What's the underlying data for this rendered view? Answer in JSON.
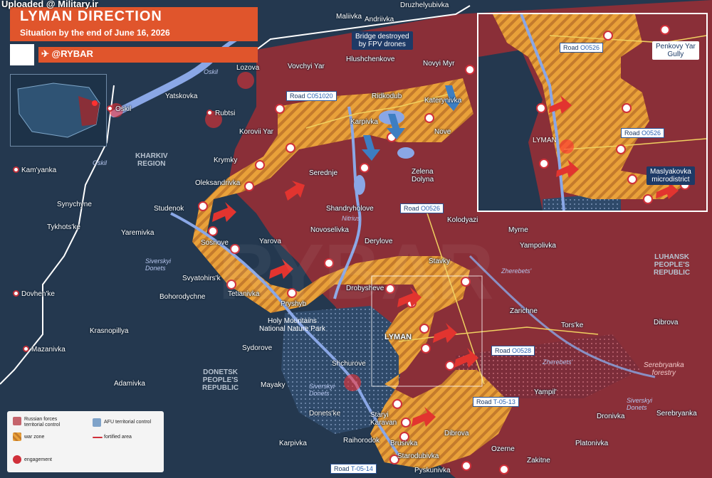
{
  "header": {
    "title": "LYMAN DIRECTION",
    "subtitle": "Situation by the end of June 16, 2026",
    "brand": "@RYBAR",
    "watermark": "Uploaded @ Military.ir"
  },
  "colors": {
    "russian_control": "#8a2f38",
    "afu_control": "#24384f",
    "war_zone": "#e9a13a",
    "river": "#8aa7e6",
    "accent": "#e0552c"
  },
  "settlements": {
    "oskil": "Oskil",
    "lozova": "Lozova",
    "yatskovka": "Yatskovka",
    "rubtsi": "Rubtsi",
    "vovchyi_yar": "Vovchyi Yar",
    "maliivka": "Maliivka",
    "andriivka": "Andriivka",
    "druzhelyubivka": "Druzhelyubivka",
    "hlushchenkove": "Hlushchenkove",
    "novyi_myr": "Novyi Myr",
    "ridkodub": "Ridkodub",
    "katerynivka": "Katerynivka",
    "karpivka_n": "Karpivka",
    "nove": "Nove",
    "korovii_yar": "Korovii Yar",
    "krymky": "Krymky",
    "serednje": "Serednje",
    "zelena_dolyna": "Zelena\nDolyna",
    "kamyanka": "Kam'yanka",
    "oleksandrivka": "Oleksandrivka",
    "synychyne": "Synychyne",
    "studenok": "Studenok",
    "shandryholove": "Shandryholove",
    "tykhotske": "Tykhots'ke",
    "yaremivka": "Yaremivka",
    "novoselivka": "Novoselivka",
    "kolodyazi": "Kolodyazi",
    "sosnove": "Sosnove",
    "yarova": "Yarova",
    "derylove": "Derylove",
    "myrne": "Myrne",
    "yampolivka": "Yampolivka",
    "stavky": "Stavky",
    "svyatohirsk": "Svyatohirs'k",
    "drobysheve": "Drobysheve",
    "dovhenke": "Dovhen'ke",
    "bohorodychne": "Bohorodychne",
    "tetianivka": "Tetianivka",
    "pryshyb": "Pryshyb",
    "zarichne": "Zarichne",
    "torske": "Tors'ke",
    "dibrova_e": "Dibrova",
    "krasnopillya": "Krasnopillya",
    "lyman": "LYMAN",
    "mazanivka": "Mazanivka",
    "sydorove": "Sydorove",
    "shchurove": "Shchurove",
    "adamivka": "Adamivka",
    "mayaky": "Mayaky",
    "yampil": "Yampil'",
    "donetske": "Donets'ke",
    "staryi_karavan": "Staryi\nKaravan",
    "dronivka": "Dronivka",
    "serebryanka": "Serebryanka",
    "raihorodok": "Raihorodok",
    "brusivka": "Brusivka",
    "dibrova_s": "Dibrova",
    "starodubivka": "Starodubivka",
    "karpivka_s": "Karpivka",
    "ozerne": "Ozerne",
    "platonivka": "Platonivka",
    "zakitne": "Zakitne",
    "pyskunivka": "Pyskunivka"
  },
  "regions": {
    "kharkiv": "KHARKIV\nREGION",
    "donetsk": "DONETSK\nPEOPLE'S\nREPUBLIC",
    "luhansk": "LUHANSK\nPEOPLE'S\nREPUBLIC",
    "holy_mountains": "Holy Mountains\nNational Nature Park",
    "serebryanka_forestry": "Serebryanka\nforestry"
  },
  "rivers": {
    "oskil_n": "Oskil",
    "oskil_w": "Oskil",
    "nitrius": "Nitrius",
    "siverskyi_donets_w": "Siverskyi\nDonets",
    "zherebets_1": "Zherebets'",
    "zherebets_2": "Zherebets'",
    "siverskyi_donets_c": "Siverskyi\nDonets",
    "siverskyi_donets_e": "Siverskyi\nDonets"
  },
  "roads": {
    "c051020": {
      "prefix": "Road",
      "code": "C051020"
    },
    "o0526_main": {
      "prefix": "Road",
      "code": "O0526"
    },
    "o0528": {
      "prefix": "Road",
      "code": "O0528"
    },
    "t0513": {
      "prefix": "Road",
      "code": "T-05-13"
    },
    "t0514": {
      "prefix": "Road",
      "code": "T-05-14"
    }
  },
  "callouts": {
    "bridge": "Bridge destroyed\nby FPV drones"
  },
  "inset": {
    "road_o0526_a": {
      "prefix": "Road",
      "code": "O0526"
    },
    "road_o0526_b": {
      "prefix": "Road",
      "code": "O0526"
    },
    "penkovy": "Penkovy Yar\nGully",
    "maslyakovka": "Maslyakovka\nmicrodistrict",
    "lyman": "LYMAN"
  },
  "legend": {
    "russian": "Russian forces\nterritorial control",
    "afu": "AFU territorial control",
    "war_zone": "war zone",
    "fortified": "fortified area",
    "engagement": "engagement"
  }
}
